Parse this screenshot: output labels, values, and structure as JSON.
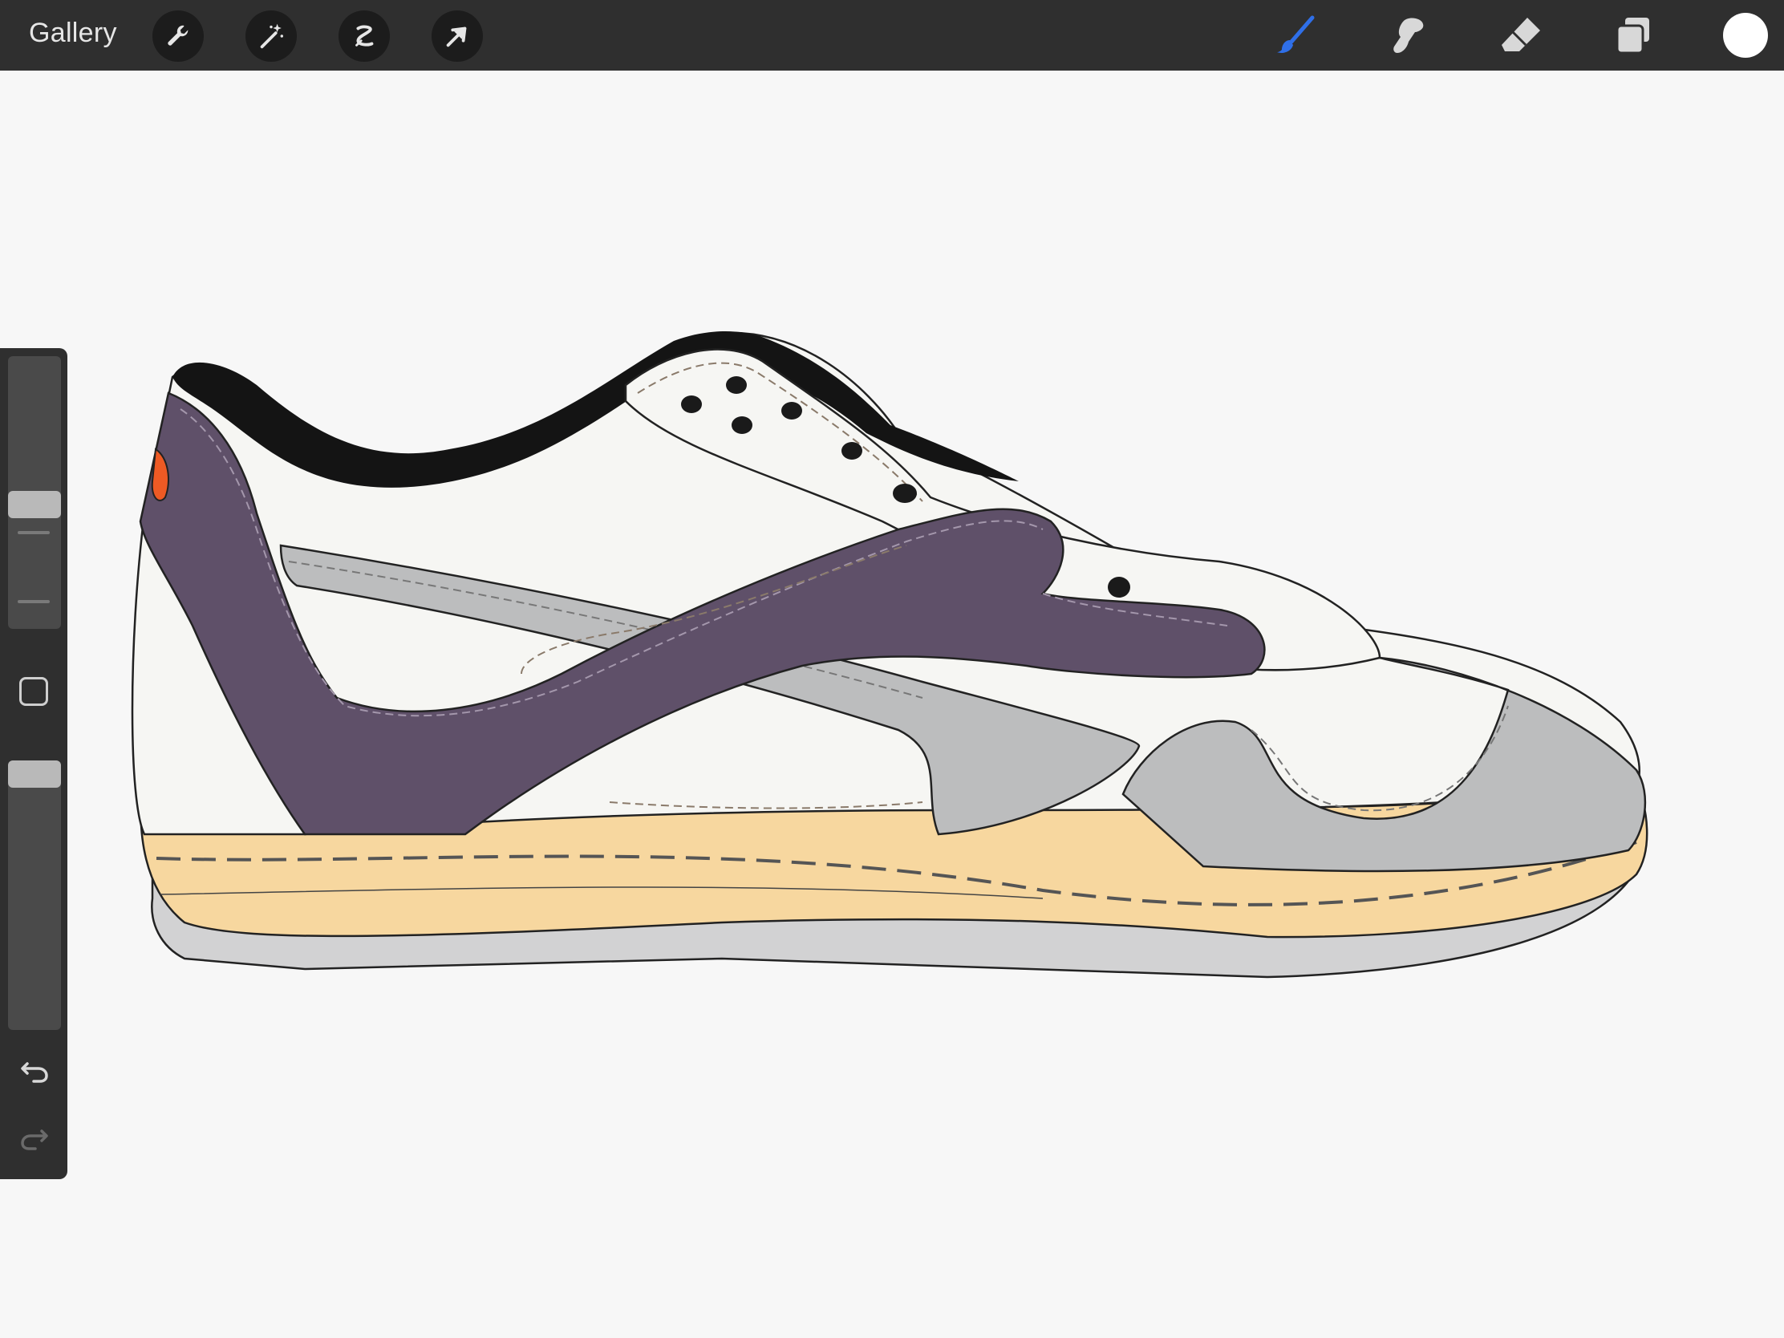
{
  "topbar": {
    "gallery_label": "Gallery",
    "left_tools": [
      {
        "name": "actions",
        "icon": "wrench-icon"
      },
      {
        "name": "adjustments",
        "icon": "magic-wand-icon"
      },
      {
        "name": "selection",
        "icon": "selection-icon"
      },
      {
        "name": "transform",
        "icon": "arrow-cursor-icon"
      }
    ],
    "right_tools": [
      {
        "name": "brush",
        "icon": "brush-icon",
        "active": true
      },
      {
        "name": "smudge",
        "icon": "smudge-icon"
      },
      {
        "name": "eraser",
        "icon": "eraser-icon"
      },
      {
        "name": "layers",
        "icon": "layers-icon"
      }
    ],
    "current_color": "#ffffff",
    "accent_color": "#2f6fe8"
  },
  "sidebar": {
    "brush_size": 0.45,
    "opacity": 1.0,
    "modify_icon": "square-icon",
    "undo_icon": "undo-icon",
    "redo_icon": "redo-icon"
  },
  "canvas": {
    "background": "#f7f7f7",
    "drawing": "sneaker-illustration",
    "palette": {
      "purple": "#5f5069",
      "gray": "#bcbdbe",
      "sole": "#f7d79f",
      "outsole": "#d2d2d3",
      "collar": "#141414",
      "white": "#f6f6f3",
      "orange": "#ee5a24"
    }
  }
}
